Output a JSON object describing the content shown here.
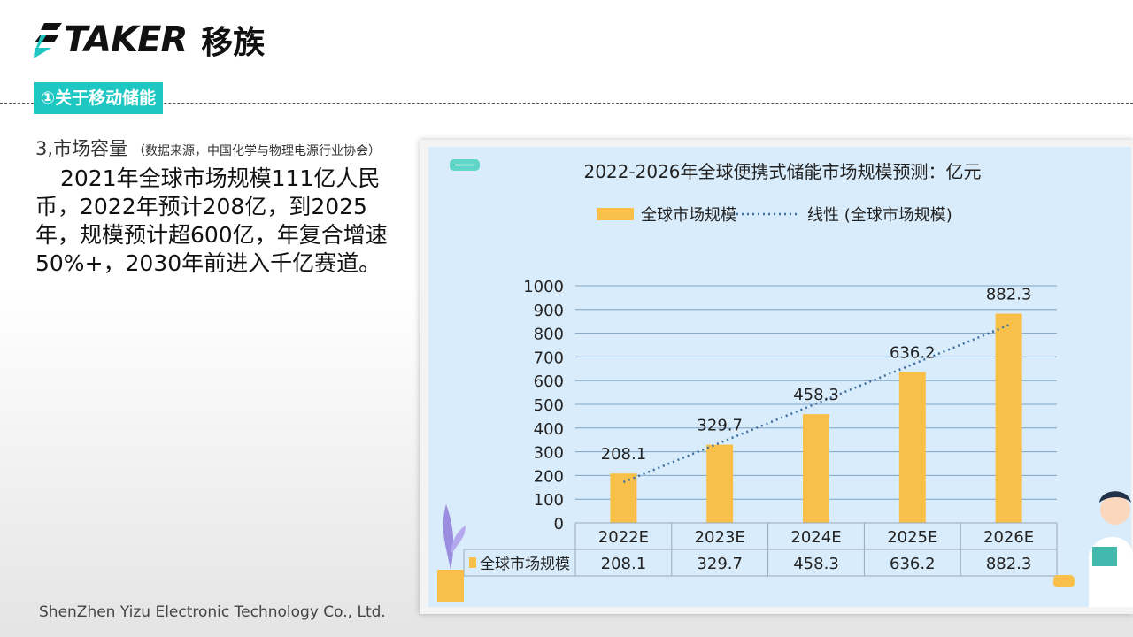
{
  "brand": {
    "wordmark": "TAKER",
    "name_cn": "移族"
  },
  "section_tag": "①关于移动储能",
  "subtitle": {
    "label": "3,市场容量",
    "note": "（数据来源，中国化学与物理电源行业协会）"
  },
  "body_text": "2021年全球市场规模111亿人民币，2022年预计208亿，到2025年，规模预计超600亿，年复合增速50%+，2030年前进入千亿赛道。",
  "footer": "ShenZhen Yizu Electronic Technology Co., Ltd.",
  "colors": {
    "accent": "#1fc7c2",
    "bar": "#f8c048",
    "trend": "#3f6f9e",
    "chart_bg": "#d9ecfb"
  },
  "chart_data": {
    "type": "bar",
    "title": "2022-2026年全球便携式储能市场规模预测：亿元",
    "categories": [
      "2022E",
      "2023E",
      "2024E",
      "2025E",
      "2026E"
    ],
    "series": [
      {
        "name": "全球市场规模",
        "values": [
          208.1,
          329.7,
          458.3,
          636.2,
          882.3
        ]
      }
    ],
    "trendline": {
      "name": "线性 (全球市场规模)",
      "type": "linear"
    },
    "data_labels": [
      "208.1",
      "329.7",
      "458.3",
      "636.2",
      "882.3"
    ],
    "ylim": [
      0,
      1000
    ],
    "yticks": [
      0,
      100,
      200,
      300,
      400,
      500,
      600,
      700,
      800,
      900,
      1000
    ],
    "grid": true,
    "legend": "top",
    "data_table": {
      "row_header": "全球市场规模",
      "values": [
        "208.1",
        "329.7",
        "458.3",
        "636.2",
        "882.3"
      ]
    }
  }
}
